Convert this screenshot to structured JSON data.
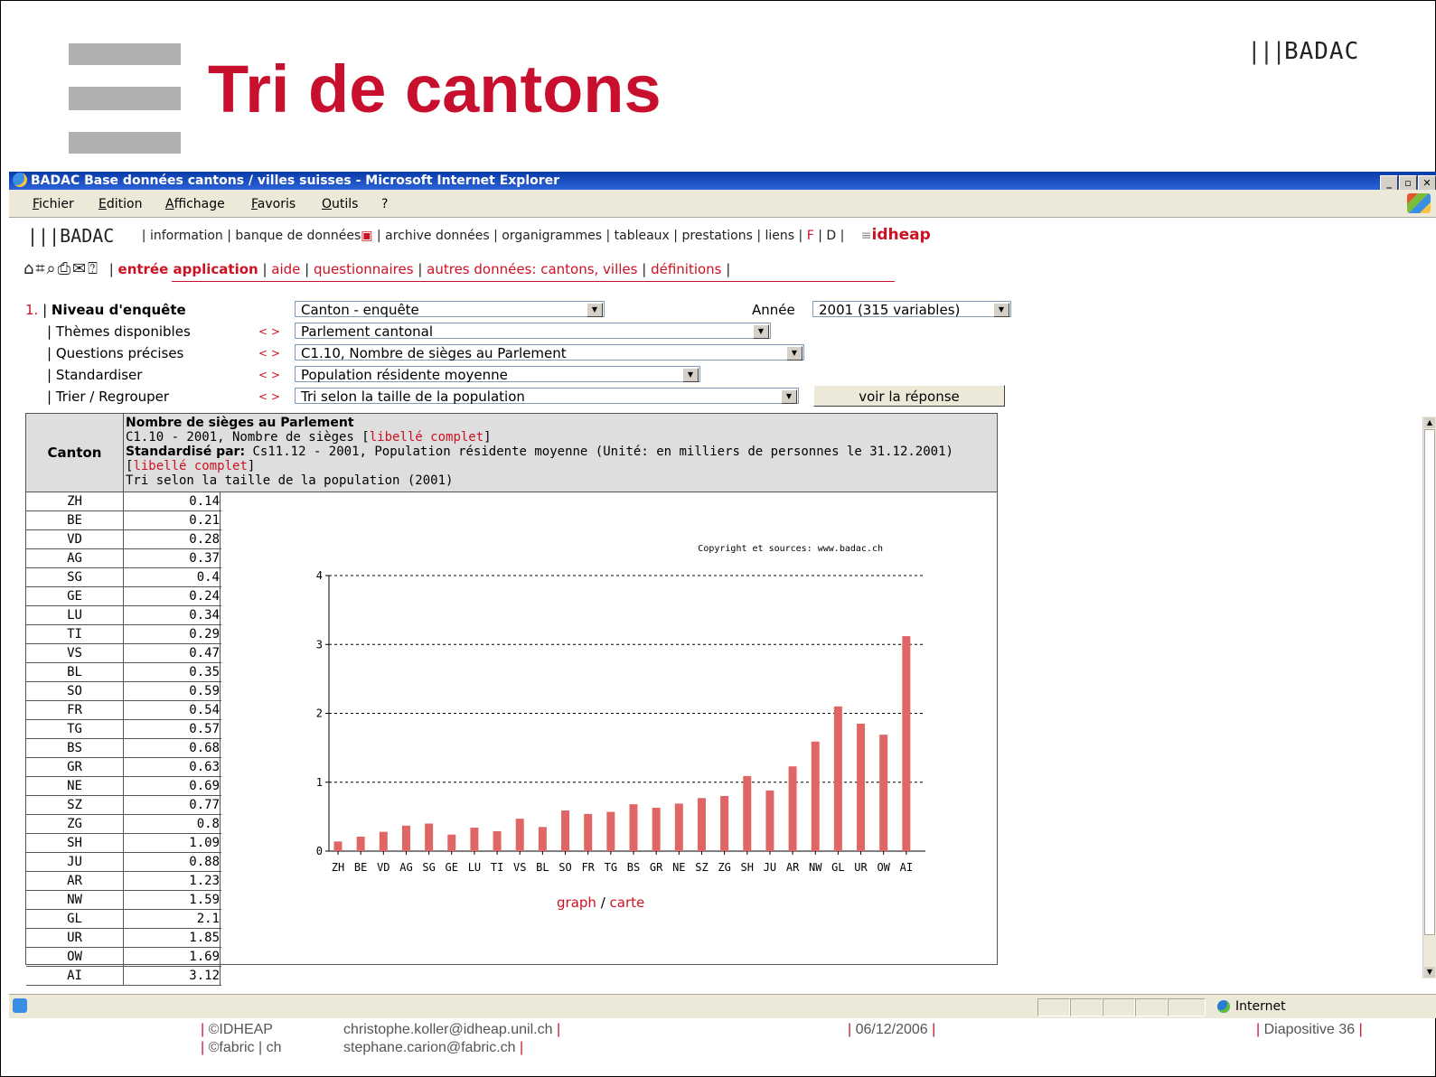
{
  "slide": {
    "title": "Tri de cantons",
    "logo": "BADAC",
    "footer": {
      "org1": "©IDHEAP",
      "org2": "©fabric | ch",
      "email1": "christophe.koller@idheap.unil.ch",
      "email2": "stephane.carion@fabric.ch",
      "date": "06/12/2006",
      "slide_label": "Diapositive 36"
    }
  },
  "browser": {
    "title": "BADAC Base données cantons / villes suisses - Microsoft Internet Explorer",
    "menu": [
      "Fichier",
      "Edition",
      "Affichage",
      "Favoris",
      "Outils",
      "?"
    ],
    "status_zone": "Internet"
  },
  "nav": {
    "logo": "BADAC",
    "items": [
      "information",
      "banque de données",
      "archive données",
      "organigrammes",
      "tableaux",
      "prestations",
      "liens"
    ],
    "lang_f": "F",
    "lang_d": "D",
    "partner": "idheap",
    "sub_items": [
      "entrée application",
      "aide",
      "questionnaires",
      "autres données: cantons, villes",
      "définitions"
    ]
  },
  "form": {
    "step": "1.",
    "niveau_label": "Niveau d'enquête",
    "niveau_value": "Canton - enquête",
    "annee_label": "Année",
    "annee_value": "2001 (315 variables)",
    "themes_label": "Thèmes disponibles",
    "themes_value": "Parlement cantonal",
    "questions_label": "Questions précises",
    "questions_value": "C1.10, Nombre de sièges au Parlement",
    "standard_label": "Standardiser",
    "standard_value": "Population résidente moyenne",
    "trier_label": "Trier / Regrouper",
    "trier_value": "Tri selon la taille de la population",
    "arrows": "< >",
    "submit": "voir la réponse"
  },
  "table": {
    "col_canton": "Canton",
    "h1": "Nombre de sièges au Parlement",
    "h2": "C1.10 - 2001, Nombre de sièges",
    "h2_link": "libellé complet",
    "h3_bold": "Standardisé par:",
    "h3": "Cs11.12 - 2001, Population résidente moyenne (Unité: en milliers de personnes le 31.12.2001)",
    "h3_link": "libellé complet",
    "h4": "Tri selon la taille de la population (2001)",
    "rows": [
      {
        "canton": "ZH",
        "value": "0.14"
      },
      {
        "canton": "BE",
        "value": "0.21"
      },
      {
        "canton": "VD",
        "value": "0.28"
      },
      {
        "canton": "AG",
        "value": "0.37"
      },
      {
        "canton": "SG",
        "value": "0.4"
      },
      {
        "canton": "GE",
        "value": "0.24"
      },
      {
        "canton": "LU",
        "value": "0.34"
      },
      {
        "canton": "TI",
        "value": "0.29"
      },
      {
        "canton": "VS",
        "value": "0.47"
      },
      {
        "canton": "BL",
        "value": "0.35"
      },
      {
        "canton": "SO",
        "value": "0.59"
      },
      {
        "canton": "FR",
        "value": "0.54"
      },
      {
        "canton": "TG",
        "value": "0.57"
      },
      {
        "canton": "BS",
        "value": "0.68"
      },
      {
        "canton": "GR",
        "value": "0.63"
      },
      {
        "canton": "NE",
        "value": "0.69"
      },
      {
        "canton": "SZ",
        "value": "0.77"
      },
      {
        "canton": "ZG",
        "value": "0.8"
      },
      {
        "canton": "SH",
        "value": "1.09"
      },
      {
        "canton": "JU",
        "value": "0.88"
      },
      {
        "canton": "AR",
        "value": "1.23"
      },
      {
        "canton": "NW",
        "value": "1.59"
      },
      {
        "canton": "GL",
        "value": "2.1"
      },
      {
        "canton": "UR",
        "value": "1.85"
      },
      {
        "canton": "OW",
        "value": "1.69"
      },
      {
        "canton": "AI",
        "value": "3.12"
      }
    ],
    "link_graph": "graph",
    "link_sep": "/",
    "link_carte": "carte"
  },
  "chart_data": {
    "type": "bar",
    "copyright": "Copyright et sources: www.badac.ch",
    "categories": [
      "ZH",
      "BE",
      "VD",
      "AG",
      "SG",
      "GE",
      "LU",
      "TI",
      "VS",
      "BL",
      "SO",
      "FR",
      "TG",
      "BS",
      "GR",
      "NE",
      "SZ",
      "ZG",
      "SH",
      "JU",
      "AR",
      "NW",
      "GL",
      "UR",
      "OW",
      "AI"
    ],
    "values": [
      0.14,
      0.21,
      0.28,
      0.37,
      0.4,
      0.24,
      0.34,
      0.29,
      0.47,
      0.35,
      0.59,
      0.54,
      0.57,
      0.68,
      0.63,
      0.69,
      0.77,
      0.8,
      1.09,
      0.88,
      1.23,
      1.59,
      2.1,
      1.85,
      1.69,
      3.12
    ],
    "yticks": [
      0,
      1,
      2,
      3,
      4
    ],
    "ylim": [
      0,
      4
    ],
    "grid": "dotted horizontal",
    "bar_color": "#e06666"
  }
}
